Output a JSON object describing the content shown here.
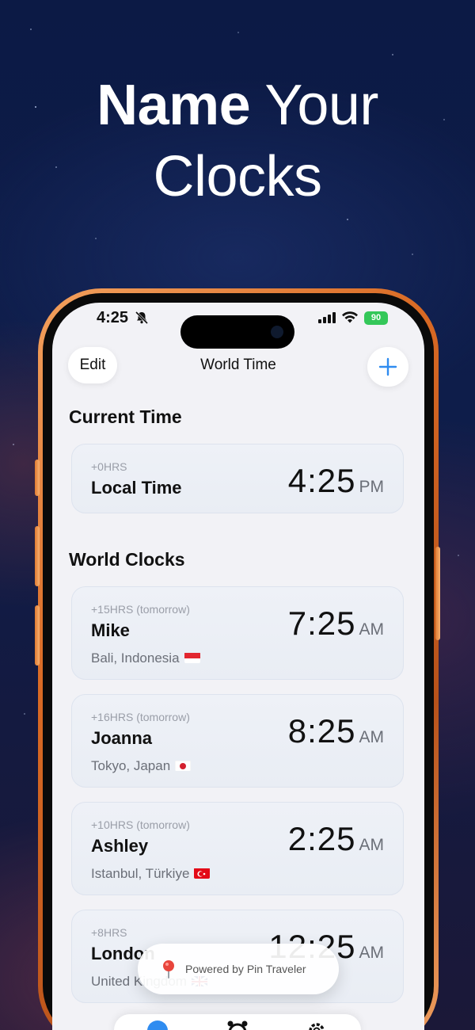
{
  "headline": {
    "bold": "Name",
    "light": "Your",
    "line2": "Clocks"
  },
  "status_bar": {
    "time": "4:25",
    "battery": "90"
  },
  "nav": {
    "edit_label": "Edit",
    "title": "World Time"
  },
  "current_section": {
    "title": "Current Time",
    "card": {
      "offset": "+0HRS",
      "name": "Local Time",
      "time": "4:25",
      "ampm": "PM"
    }
  },
  "world_section": {
    "title": "World Clocks",
    "cards": [
      {
        "offset": "+15HRS (tomorrow)",
        "name": "Mike",
        "place": "Bali, Indonesia",
        "time": "7:25",
        "ampm": "AM",
        "flag": "indonesia"
      },
      {
        "offset": "+16HRS (tomorrow)",
        "name": "Joanna",
        "place": "Tokyo, Japan",
        "time": "8:25",
        "ampm": "AM",
        "flag": "japan"
      },
      {
        "offset": "+10HRS (tomorrow)",
        "name": "Ashley",
        "place": "Istanbul, Türkiye",
        "time": "2:25",
        "ampm": "AM",
        "flag": "turkey"
      },
      {
        "offset": "+8HRS",
        "name": "London",
        "place": "United Kingdom",
        "time": "12:25",
        "ampm": "AM",
        "flag": "uk"
      }
    ]
  },
  "toast": {
    "text": "Powered by Pin Traveler"
  },
  "colors": {
    "accent": "#2f8cf0",
    "battery": "#34c759",
    "frame": "#d96a24"
  }
}
